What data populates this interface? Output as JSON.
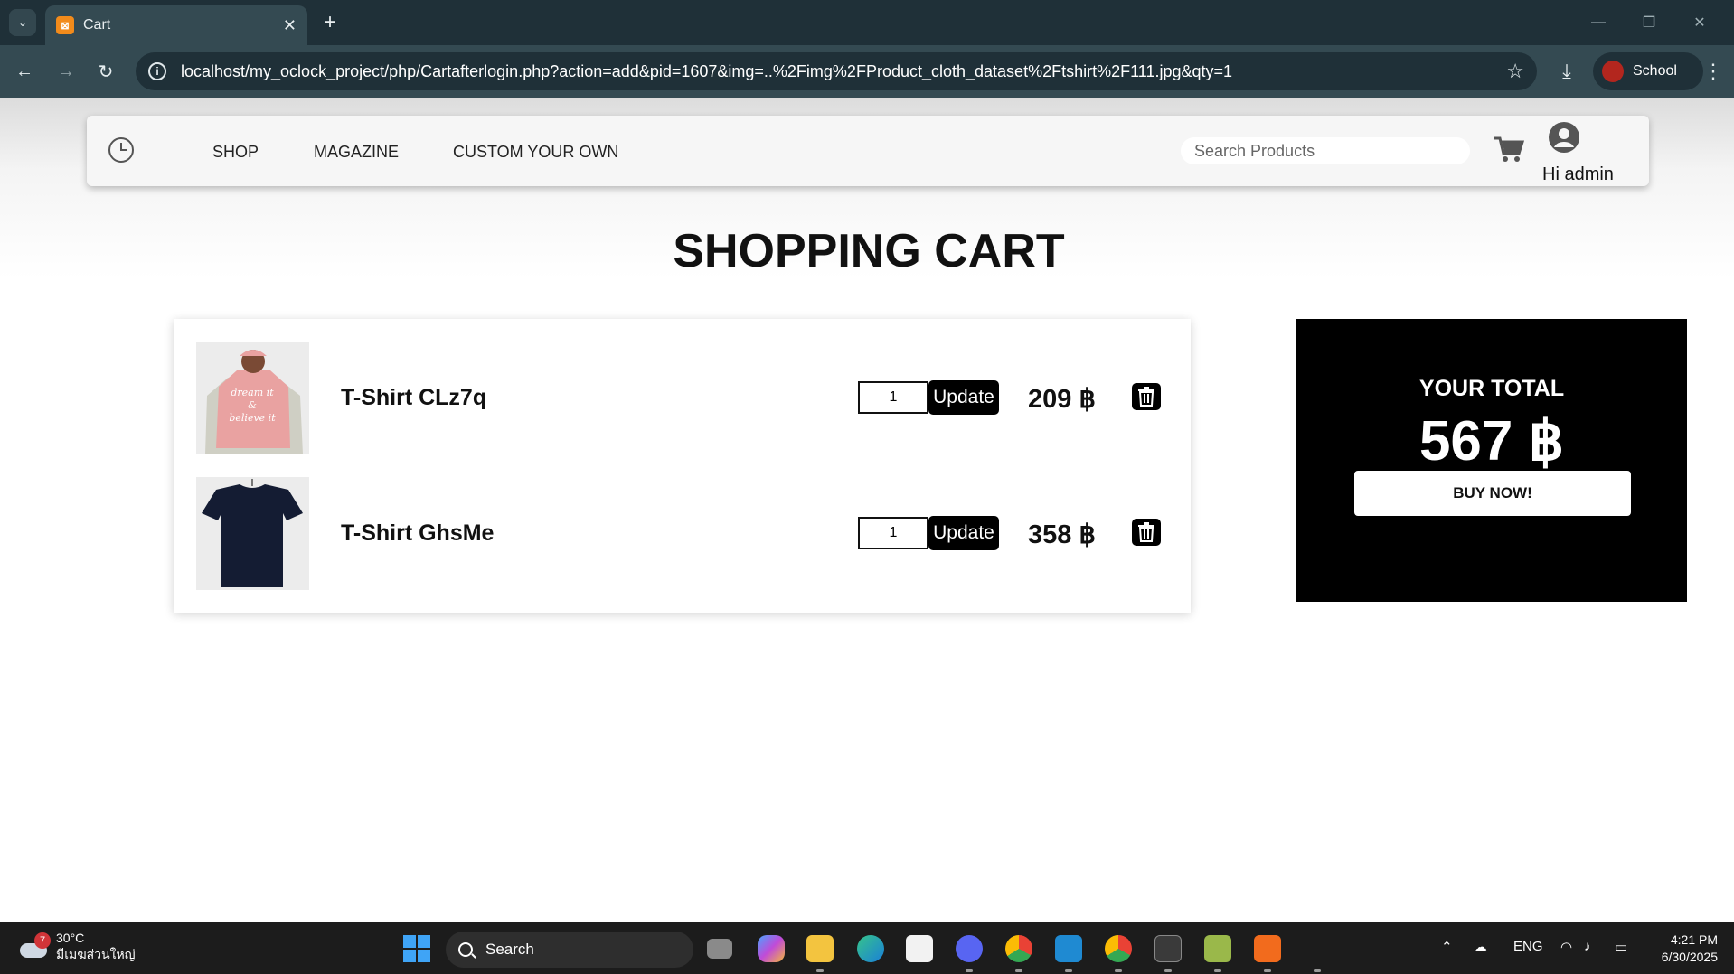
{
  "browser": {
    "tab_title": "Cart",
    "url": "localhost/my_oclock_project/php/Cartafterlogin.php?action=add&pid=1607&img=..%2Fimg%2FProduct_cloth_dataset%2Ftshirt%2F111.jpg&qty=1",
    "profile_name": "School"
  },
  "nav": {
    "links": [
      "SHOP",
      "MAGAZINE",
      "CUSTOM YOUR OWN"
    ],
    "search_placeholder": "Search Products",
    "greeting": "Hi admin"
  },
  "page_title": "SHOPPING CART",
  "cart": {
    "items": [
      {
        "name": "T-Shirt CLz7q",
        "qty": "1",
        "price": "209 ฿",
        "image": "pink-tshirt"
      },
      {
        "name": "T-Shirt GhsMe",
        "qty": "1",
        "price": "358 ฿",
        "image": "navy-tshirt"
      }
    ],
    "update_label": "Update"
  },
  "summary": {
    "label": "YOUR TOTAL",
    "total": "567 ฿",
    "buy_label": "BUY NOW!"
  },
  "taskbar": {
    "weather_temp": "30°C",
    "weather_location": "มีเมฆส่วนใหญ่",
    "weather_badge": "7",
    "search_label": "Search",
    "language": "ENG",
    "time": "4:21 PM",
    "date": "6/30/2025"
  },
  "colors": {
    "chrome_dark": "#1f3038",
    "chrome_light": "#344a52",
    "accent_black": "#000000"
  }
}
